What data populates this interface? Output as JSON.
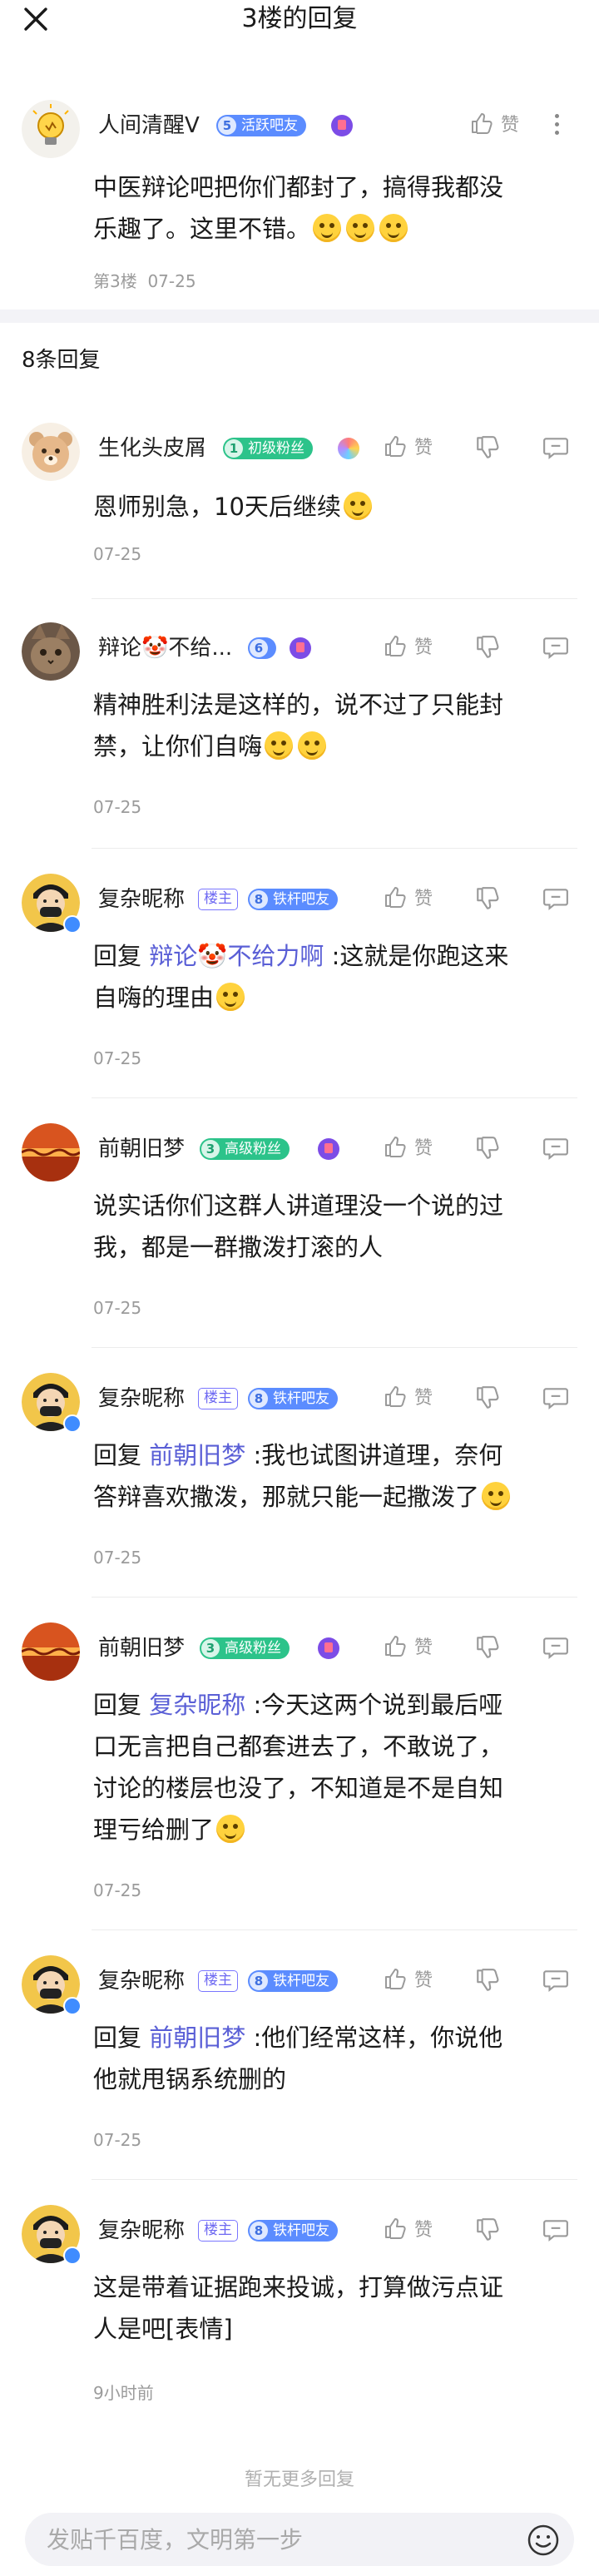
{
  "header": {
    "title": "3楼的回复",
    "close_icon": "close-icon"
  },
  "main_post": {
    "author": "人间清醒V",
    "level": "5",
    "level_title": "活跃吧友",
    "like_label": "赞",
    "content_lines": [
      "中医辩论吧把你们都封了，搞得我都没",
      "乐趣了。这里不错。"
    ],
    "floor": "第3楼",
    "date": "07-25"
  },
  "replies_header": "8条回复",
  "replies": [
    {
      "author": "生化头皮屑",
      "level": "1",
      "level_title": "初级粉丝",
      "like_label": "赞",
      "reply_to": "",
      "lines": [
        "恩师别急，10天后继续"
      ],
      "time": "07-25"
    },
    {
      "author": "辩论🤡不给...",
      "level": "6",
      "level_title": "",
      "like_label": "赞",
      "reply_to": "",
      "lines": [
        "精神胜利法是这样的，说不过了只能封",
        "禁，让你们自嗨"
      ],
      "time": "07-25"
    },
    {
      "author": "复杂昵称",
      "host_tag": "楼主",
      "level": "8",
      "level_title": "铁杆吧友",
      "like_label": "赞",
      "reply_prefix": "回复",
      "reply_to": "辩论🤡不给力啊",
      "lines": [
        ":这就是你跑这来",
        "自嗨的理由"
      ],
      "time": "07-25"
    },
    {
      "author": "前朝旧梦",
      "level": "3",
      "level_title": "高级粉丝",
      "like_label": "赞",
      "reply_to": "",
      "lines": [
        "说实话你们这群人讲道理没一个说的过",
        "我，都是一群撒泼打滚的人"
      ],
      "time": "07-25"
    },
    {
      "author": "复杂昵称",
      "host_tag": "楼主",
      "level": "8",
      "level_title": "铁杆吧友",
      "like_label": "赞",
      "reply_prefix": "回复",
      "reply_to": "前朝旧梦",
      "lines": [
        ":我也试图讲道理，奈何",
        "答辩喜欢撒泼，那就只能一起撒泼了"
      ],
      "time": "07-25"
    },
    {
      "author": "前朝旧梦",
      "level": "3",
      "level_title": "高级粉丝",
      "like_label": "赞",
      "reply_prefix": "回复",
      "reply_to": "复杂昵称",
      "lines": [
        ":今天这两个说到最后哑",
        "口无言把自己都套进去了，不敢说了，",
        "讨论的楼层也没了，不知道是不是自知",
        "理亏给删了"
      ],
      "time": "07-25"
    },
    {
      "author": "复杂昵称",
      "host_tag": "楼主",
      "level": "8",
      "level_title": "铁杆吧友",
      "like_label": "赞",
      "reply_prefix": "回复",
      "reply_to": "前朝旧梦",
      "lines": [
        ":他们经常这样，你说他",
        "他就甩锅系统删的"
      ],
      "time": "07-25"
    },
    {
      "author": "复杂昵称",
      "host_tag": "楼主",
      "level": "8",
      "level_title": "铁杆吧友",
      "like_label": "赞",
      "reply_to": "",
      "lines": [
        "这是带着证据跑来投诚，打算做污点证",
        "人是吧[表情]"
      ],
      "time": "9小时前"
    }
  ],
  "no_more_text": "暂无更多回复",
  "input": {
    "placeholder": "发贴千百度，文明第一步"
  },
  "colors": {
    "link": "#5a5fd6",
    "blue_badge": "#5b8cff",
    "green_badge": "#2cc38a",
    "muted": "#9b9b9b"
  }
}
